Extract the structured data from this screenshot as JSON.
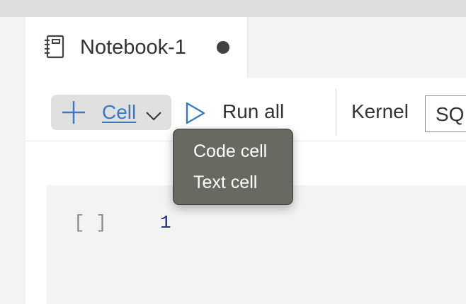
{
  "tab": {
    "title": "Notebook-1",
    "icon": "notebook-icon",
    "dirty": true
  },
  "toolbar": {
    "add_cell_label": "Cell",
    "add_cell_icon": "plus-icon",
    "dropdown_icon": "chevron-down-icon",
    "run_all_label": "Run all",
    "run_all_icon": "play-icon",
    "kernel_label": "Kernel",
    "kernel_value": "SQ"
  },
  "dropdown": {
    "items": [
      {
        "label": "Code cell"
      },
      {
        "label": "Text cell"
      }
    ]
  },
  "cell": {
    "execution_count": "[ ]",
    "line_number": "1"
  },
  "colors": {
    "accent": "#3a78c2",
    "menu_background": "#6a6961",
    "dirty_dot": "#424242"
  }
}
